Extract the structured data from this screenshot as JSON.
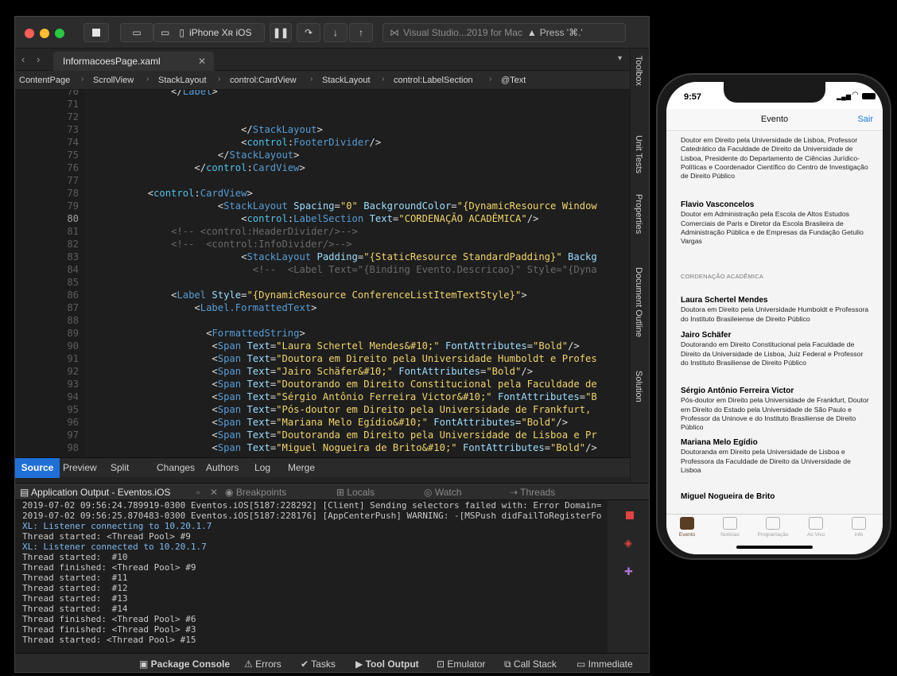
{
  "toolbar": {
    "device": "iPhone Xʀ iOS",
    "status": "Visual Studio...2019 for Mac",
    "search": "Press '⌘.'"
  },
  "file_tab": "InformacoesPage.xaml",
  "breadcrumb": [
    "ContentPage",
    "ScrollView",
    "StackLayout",
    "control:CardView",
    "StackLayout",
    "control:LabelSection",
    "@Text"
  ],
  "code": [
    {
      "n": "70",
      "h": "            &lt;/<span class=t>Label</span>&gt;"
    },
    {
      "n": "71",
      "h": ""
    },
    {
      "n": "72",
      "h": ""
    },
    {
      "n": "73",
      "h": "                        &lt;/<span class=t>StackLayout</span>&gt;"
    },
    {
      "n": "74",
      "h": "                        &lt;<span class=n>control</span>:<span class=t>FooterDivider</span>/&gt;"
    },
    {
      "n": "75",
      "h": "                    &lt;/<span class=t>StackLayout</span>&gt;"
    },
    {
      "n": "76",
      "h": "                &lt;/<span class=n>control</span>:<span class=t>CardView</span>&gt;"
    },
    {
      "n": "77",
      "h": ""
    },
    {
      "n": "78",
      "h": "        &lt;<span class=n>control</span>:<span class=t>CardView</span>&gt;"
    },
    {
      "n": "79",
      "h": "                    &lt;<span class=t>StackLayout</span> <span class=a>Spacing</span>=<span class=s>\"0\"</span> <span class=a>BackgroundColor</span>=<span class=s>\"{DynamicResource Window</span>"
    },
    {
      "n": "80",
      "h": "                        &lt;<span class=n>control</span>:<span class=t>LabelSection</span> <span class=a>Text</span>=<span class=s>\"CORDENAÇÃO ACADÊMICA\"</span>/&gt;",
      "cur": true
    },
    {
      "n": "81",
      "h": "            <span class=c>&lt;!-- &lt;control:HeaderDivider/&gt;--&gt;</span>"
    },
    {
      "n": "82",
      "h": "            <span class=c>&lt;!--  &lt;control:InfoDivider/&gt;--&gt;</span>"
    },
    {
      "n": "83",
      "h": "                        &lt;<span class=t>StackLayout</span> <span class=a>Padding</span>=<span class=s>\"{StaticResource StandardPadding}\"</span> <span class=a>Backg</span>"
    },
    {
      "n": "84",
      "h": "                          <span class=c>&lt;!--  &lt;Label Text=\"{Binding Evento.Descricao}\" Style=\"{Dyna</span>"
    },
    {
      "n": "85",
      "h": ""
    },
    {
      "n": "86",
      "h": "            &lt;<span class=t>Label</span> <span class=a>Style</span>=<span class=s>\"{DynamicResource ConferenceListItemTextStyle}\"</span>&gt;"
    },
    {
      "n": "87",
      "h": "                &lt;<span class=t>Label.FormattedText</span>&gt;"
    },
    {
      "n": "88",
      "h": ""
    },
    {
      "n": "89",
      "h": "                  &lt;<span class=t>FormattedString</span>&gt;"
    },
    {
      "n": "90",
      "h": "                   &lt;<span class=t>Span</span> <span class=a>Text</span>=<span class=s>\"Laura Schertel Mendes&amp;#10;\"</span> <span class=a>FontAttributes</span>=<span class=s>\"Bold\"</span>/&gt;"
    },
    {
      "n": "91",
      "h": "                   &lt;<span class=t>Span</span> <span class=a>Text</span>=<span class=s>\"Doutora em Direito pela Universidade Humboldt e Profes</span>"
    },
    {
      "n": "92",
      "h": "                   &lt;<span class=t>Span</span> <span class=a>Text</span>=<span class=s>\"Jairo Schäfer&amp;#10;\"</span> <span class=a>FontAttributes</span>=<span class=s>\"Bold\"</span>/&gt;"
    },
    {
      "n": "93",
      "h": "                   &lt;<span class=t>Span</span> <span class=a>Text</span>=<span class=s>\"Doutorando em Direito Constitucional pela Faculdade de</span>"
    },
    {
      "n": "94",
      "h": "                   &lt;<span class=t>Span</span> <span class=a>Text</span>=<span class=s>\"Sérgio Antônio Ferreira Victor&amp;#10;\"</span> <span class=a>FontAttributes</span>=<span class=s>\"B</span>"
    },
    {
      "n": "95",
      "h": "                   &lt;<span class=t>Span</span> <span class=a>Text</span>=<span class=s>\"Pós-doutor em Direito pela Universidade de Frankfurt, </span>"
    },
    {
      "n": "96",
      "h": "                   &lt;<span class=t>Span</span> <span class=a>Text</span>=<span class=s>\"Mariana Melo Egídio&amp;#10;\"</span> <span class=a>FontAttributes</span>=<span class=s>\"Bold\"</span>/&gt;"
    },
    {
      "n": "97",
      "h": "                   &lt;<span class=t>Span</span> <span class=a>Text</span>=<span class=s>\"Doutoranda em Direito pela Universidade de Lisboa e Pr</span>"
    },
    {
      "n": "98",
      "h": "                   &lt;<span class=t>Span</span> <span class=a>Text</span>=<span class=s>\"Miguel Nogueira de Brito&amp;#10;\"</span> <span class=a>FontAttributes</span>=<span class=s>\"Bold\"</span>/&gt;"
    }
  ],
  "editor_tabs": [
    "Source",
    "Preview",
    "Split",
    "Changes",
    "Authors",
    "Log",
    "Merge"
  ],
  "pad_tabs": [
    "Application Output - Eventos.iOS",
    "Breakpoints",
    "Locals",
    "Watch",
    "Threads"
  ],
  "output": [
    {
      "t": "2019-07-02 09:56:24.789919-0300 Eventos.iOS[5187:228292] [Client] Sending selectors failed with: Error Domain="
    },
    {
      "t": "2019-07-02 09:56:25.870483-0300 Eventos.iOS[5187:228176] [AppCenterPush] WARNING: -[MSPush didFailToRegisterFo"
    },
    {
      "t": "XL: Listener connecting to 10.20.1.7",
      "blue": true
    },
    {
      "t": "Thread started: <Thread Pool> #9"
    },
    {
      "t": "XL: Listener connected to 10.20.1.7",
      "blue": true
    },
    {
      "t": "Thread started:  #10"
    },
    {
      "t": "Thread finished: <Thread Pool> #9"
    },
    {
      "t": "Thread started:  #11"
    },
    {
      "t": "Thread started:  #12"
    },
    {
      "t": "Thread started:  #13"
    },
    {
      "t": "Thread started:  #14"
    },
    {
      "t": "Thread finished: <Thread Pool> #6"
    },
    {
      "t": "Thread finished: <Thread Pool> #3"
    },
    {
      "t": "Thread started: <Thread Pool> #15"
    }
  ],
  "statusbar": [
    "Package Console",
    "Errors",
    "Tasks",
    "Tool Output",
    "Emulator",
    "Call Stack",
    "Immediate"
  ],
  "side_labels": [
    "Toolbox",
    "Unit Tests",
    "Properties",
    "Document Outline",
    "Solution"
  ],
  "phone": {
    "time": "9:57",
    "title": "Evento",
    "right": "Sair",
    "blocks": [
      {
        "name": "",
        "text": "Doutor em Direito pela Universidade de Lisboa, Professor Catedrático da Faculdade de Direito da Universidade de Lisboa, Presidente do Departamento de Ciências Jurídico-Políticas e Coordenador Científico do Centro de Investigação de Direito Público"
      },
      {
        "name": "Flavio Vasconcelos",
        "text": "Doutor em Administração pela Escola de Altos Estudos Comerciais de Paris e Diretor da Escola Brasileira de Administração Pública e de Empresas da Fundação Getulio Vargas"
      },
      {
        "name": "Laura Schertel Mendes",
        "text": "Doutora em Direito pela Universidade Humboldt e Professora do Instituto Brasileiense de Direito Público"
      },
      {
        "name": "Jairo Schäfer",
        "text": "Doutorando em Direito Constitucional pela Faculdade de Direito da Universidade de Lisboa, Juiz Federal e Professor do Instituto Brasiliense de Direito Público"
      },
      {
        "name": "Sérgio Antônio Ferreira Victor",
        "text": "Pós-doutor em Direito pela Universidade de Frankfurt, Doutor em Direito do Estado pela Universidade de São Paulo e Professor da Uninove e do Instituto Brasiliense de Direito Público"
      },
      {
        "name": "Mariana Melo Egídio",
        "text": "Doutoranda em Direito pela Universidade de Lisboa e Professora da Faculdade de Direito da Universidade de Lisboa"
      },
      {
        "name": "Miguel Nogueira de Brito",
        "text": ""
      }
    ],
    "section": "CORDENAÇÃO ACADÊMICA",
    "tabs": [
      "Evento",
      "Notícias",
      "Programação",
      "Ao Vivo",
      "Info"
    ]
  }
}
